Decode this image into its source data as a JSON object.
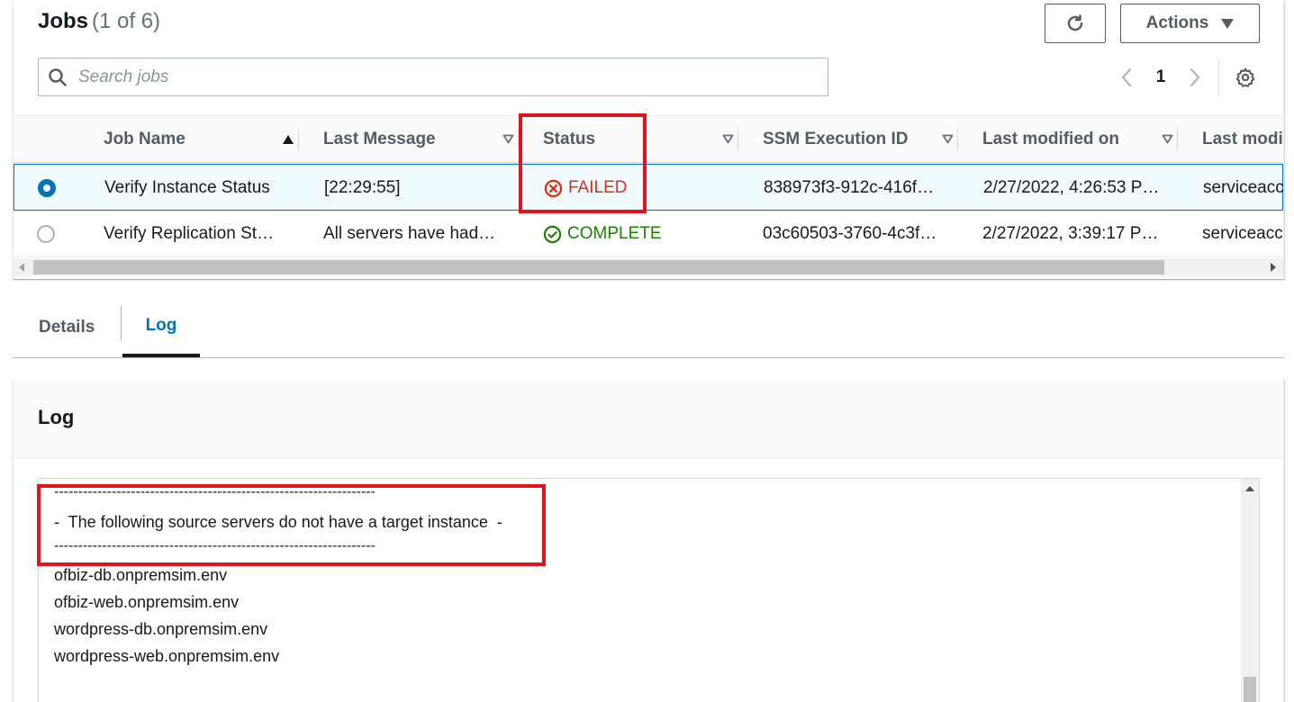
{
  "jobs": {
    "title": "Jobs",
    "count": "(1 of 6)",
    "actions_label": "Actions",
    "search_placeholder": "Search jobs",
    "page_number": "1"
  },
  "table": {
    "headers": {
      "job_name": "Job Name",
      "last_message": "Last Message",
      "status": "Status",
      "ssm_execution_id": "SSM Execution ID",
      "last_modified_on": "Last modified on",
      "last_modified_by": "Last modi"
    },
    "rows": [
      {
        "selected": true,
        "job_name": "Verify Instance Status",
        "last_message": "[22:29:55]",
        "status": "FAILED",
        "ssm_execution_id": "838973f3-912c-416f…",
        "last_modified_on": "2/27/2022, 4:26:53 P…",
        "last_modified_by": "serviceacco"
      },
      {
        "selected": false,
        "job_name": "Verify Replication St…",
        "last_message": "All servers have had…",
        "status": "COMPLETE",
        "ssm_execution_id": "03c60503-3760-4c3f…",
        "last_modified_on": "2/27/2022, 3:39:17 P…",
        "last_modified_by": "serviceacco"
      }
    ]
  },
  "tabs": {
    "details": "Details",
    "log": "Log",
    "active": "log"
  },
  "log": {
    "title": "Log",
    "lines": [
      "-------------------------------------------------------------------",
      "-  The following source servers do not have a target instance  -",
      "-------------------------------------------------------------------",
      "ofbiz-db.onpremsim.env",
      "ofbiz-web.onpremsim.env",
      "wordpress-db.onpremsim.env",
      "wordpress-web.onpremsim.env"
    ]
  },
  "colors": {
    "accent": "#0073bb",
    "failed": "#d13212",
    "complete": "#1d8102",
    "highlight": "#e0141e"
  }
}
